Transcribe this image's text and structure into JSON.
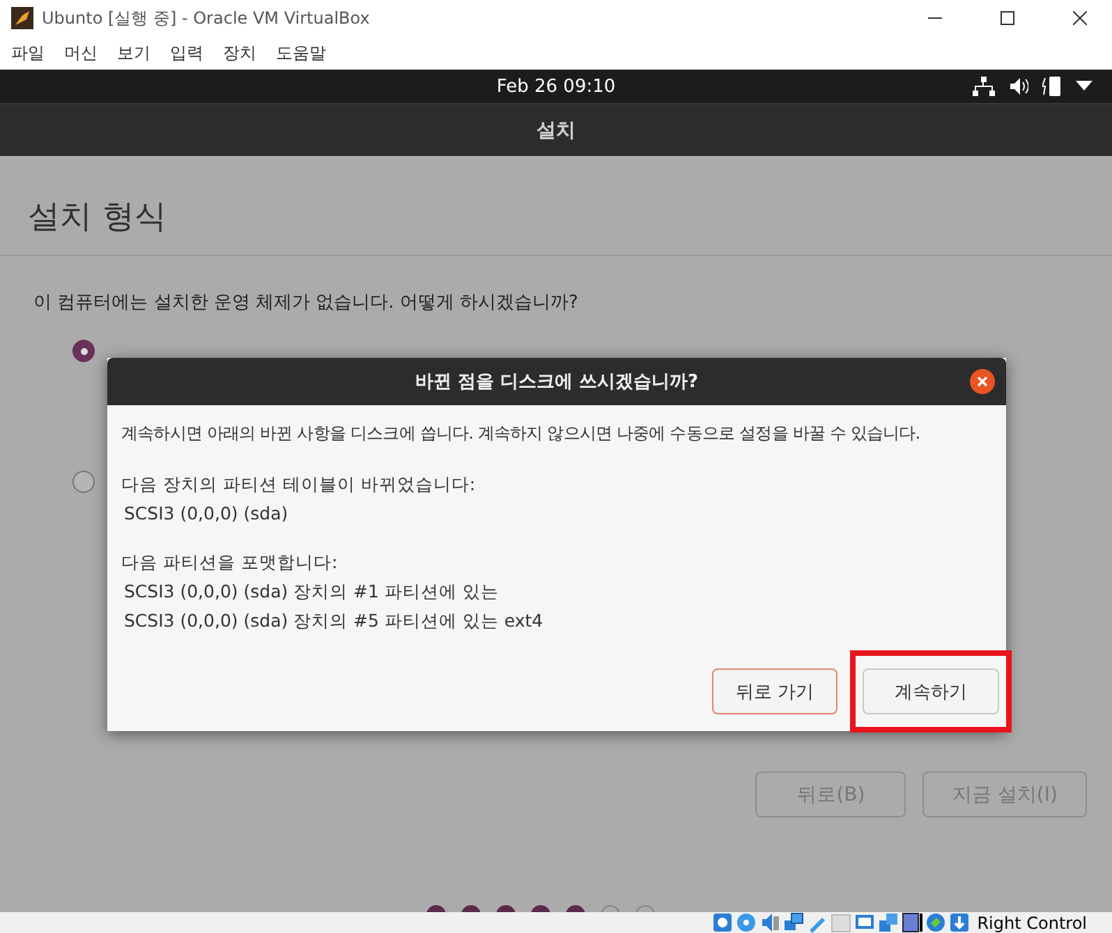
{
  "window": {
    "title": "Ubunto [실행 중] - Oracle VM VirtualBox"
  },
  "menu": [
    "파일",
    "머신",
    "보기",
    "입력",
    "장치",
    "도움말"
  ],
  "top_bar": {
    "clock": "Feb 26  09:10"
  },
  "header": {
    "title": "설치"
  },
  "page": {
    "heading": "설치 형식",
    "question": "이 컴퓨터에는 설치한 운영 체제가 없습니다. 어떻게 하시겠습니까?",
    "options": [
      {
        "selected": true
      },
      {
        "selected": false
      }
    ],
    "buttons": [
      {
        "label": "뒤로(B)"
      },
      {
        "label": "지금 설치(I)"
      }
    ],
    "progress_dots": [
      {
        "filled": true
      },
      {
        "filled": true
      },
      {
        "filled": true
      },
      {
        "filled": true
      },
      {
        "filled": true
      },
      {
        "filled": false
      },
      {
        "filled": false
      }
    ]
  },
  "dialog": {
    "title": "바뀐 점을 디스크에 쓰시겠습니까?",
    "message": "계속하시면 아래의 바뀐 사항을 디스크에 씁니다. 계속하지 않으시면 나중에 수동으로 설정을 바꿀 수 있습니다.",
    "sections": [
      {
        "heading": "다음 장치의 파티션 테이블이 바뀌었습니다:",
        "items": [
          "SCSI3 (0,0,0) (sda)"
        ]
      },
      {
        "heading": "다음 파티션을 포맷합니다:",
        "items": [
          "SCSI3 (0,0,0) (sda) 장치의 #1 파티션에 있는",
          "SCSI3 (0,0,0) (sda) 장치의 #5 파티션에 있는 ext4"
        ]
      }
    ],
    "buttons": [
      {
        "label": "뒤로 가기",
        "kind": "outlined",
        "highlighted": false
      },
      {
        "label": "계속하기",
        "kind": "plain",
        "highlighted": true
      }
    ]
  },
  "status_bar": {
    "host_key": "Right Control"
  }
}
